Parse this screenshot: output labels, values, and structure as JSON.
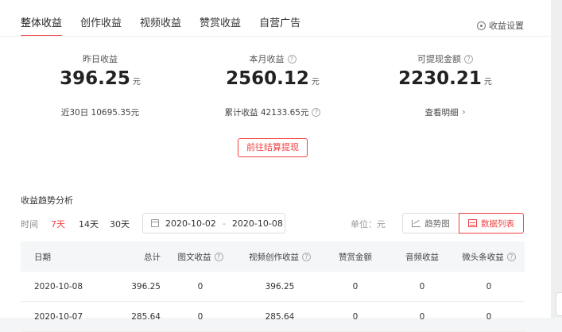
{
  "tabs": [
    "整体收益",
    "创作收益",
    "视频收益",
    "赞赏收益",
    "自营广告"
  ],
  "settings_label": "收益设置",
  "stats": [
    {
      "label": "昨日收益",
      "value": "396.25",
      "unit": "元",
      "sub": "近30日 10695.35元"
    },
    {
      "label": "本月收益",
      "value": "2560.12",
      "unit": "元",
      "sub": "累计收益 42133.65元"
    },
    {
      "label": "可提现金额",
      "value": "2230.21",
      "unit": "元",
      "sub": "查看明细"
    }
  ],
  "settle_button": "前往结算提现",
  "analysis": {
    "title": "收益趋势分析",
    "time_label": "时间",
    "ranges": [
      "7天",
      "14天",
      "30天"
    ],
    "active_range": "7天",
    "date_start": "2020-10-02",
    "date_sep": "-",
    "date_end": "2020-10-08",
    "unit_label": "单位：元",
    "view_trend": "趋势图",
    "view_list": "数据列表"
  },
  "table": {
    "headers": [
      "日期",
      "总计",
      "图文收益",
      "视频创作收益",
      "赞赏金额",
      "音频收益",
      "微头条收益"
    ],
    "rows": [
      [
        "2020-10-08",
        "396.25",
        "0",
        "396.25",
        "0",
        "0",
        "0"
      ],
      [
        "2020-10-07",
        "285.64",
        "0",
        "285.64",
        "0",
        "0",
        "0"
      ]
    ]
  },
  "colors": {
    "accent": "#f04142"
  },
  "icons": {
    "settings": "settings-icon",
    "help": "question-circle-icon",
    "calendar": "calendar-icon",
    "trend": "line-chart-icon",
    "list": "table-icon"
  }
}
